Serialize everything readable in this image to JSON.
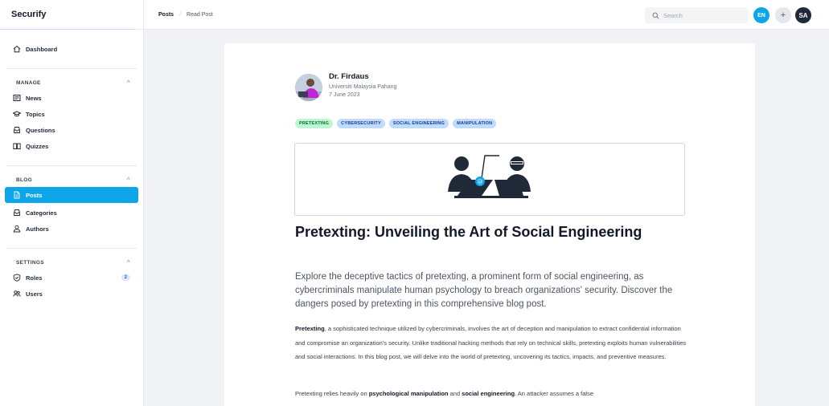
{
  "brand": "Securify",
  "sidebar": {
    "dashboard": "Dashboard",
    "manage": {
      "heading": "MANAGE",
      "items": [
        "News",
        "Topics",
        "Questions",
        "Quizzes"
      ]
    },
    "blog": {
      "heading": "BLOG",
      "items": [
        "Posts",
        "Categories",
        "Authors"
      ]
    },
    "settings": {
      "heading": "SETTINGS",
      "roles": "Roles",
      "roles_count": "2",
      "users": "Users"
    }
  },
  "topbar": {
    "breadcrumb": [
      "Posts",
      "Read Post"
    ],
    "search_placeholder": "Search",
    "lang": "EN",
    "plus": "+",
    "user_initials": "SA"
  },
  "post": {
    "author": "Dr. Firdaus",
    "org": "Universiti Malaysia Pahang",
    "date": "7 June 2023",
    "tags": [
      "PRETEXTING",
      "CYBERSECURITY",
      "SOCIAL ENGINEERING",
      "MANIPULATION"
    ],
    "title": "Pretexting: Unveiling the Art of Social Engineering",
    "lead": "Explore the deceptive tactics of pretexting, a prominent form of social engineering, as cybercriminals manipulate human psychology to breach organizations' security. Discover the dangers posed by pretexting in this comprehensive blog post.",
    "p1_bold": "Pretexting",
    "p1_rest": ", a sophisticated technique utilized by cybercriminals, involves the art of deception and manipulation to extract confidential information and compromise an organization's security. Unlike traditional hacking methods that rely on technical skills, pretexting exploits human vulnerabilities and social interactions. In this blog post, we will delve into the world of pretexting, uncovering its tactics, impacts, and preventive measures.",
    "p2_a": "Pretexting relies heavily on ",
    "p2_b1": "psychological manipulation",
    "p2_c": " and ",
    "p2_b2": "social engineering",
    "p2_d": ". An attacker assumes a false"
  },
  "colors": {
    "accent": "#0ea5e9",
    "tag_green": "#bbf7d0",
    "tag_blue": "#bfdbfe"
  }
}
